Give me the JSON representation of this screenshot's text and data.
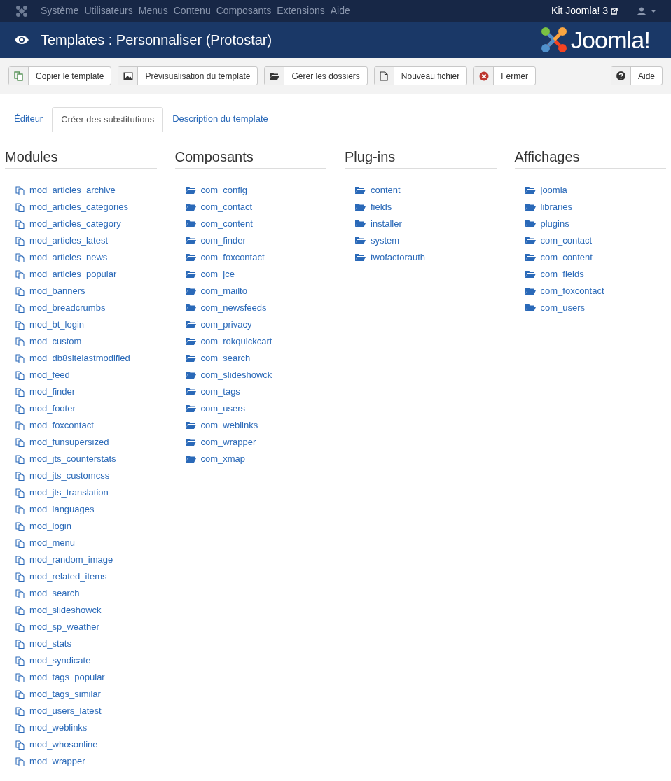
{
  "topbar": {
    "menu": [
      "Système",
      "Utilisateurs",
      "Menus",
      "Contenu",
      "Composants",
      "Extensions",
      "Aide"
    ],
    "site_link": "Kit Joomla! 3"
  },
  "header": {
    "title": "Templates : Personnaliser (Protostar)",
    "logo_text": "Joomla!"
  },
  "toolbar": {
    "buttons": [
      "Copier le template",
      "Prévisualisation du template",
      "Gérer les dossiers",
      "Nouveau fichier",
      "Fermer"
    ],
    "help_button": "Aide"
  },
  "tabs": [
    {
      "label": "Éditeur",
      "selected": false
    },
    {
      "label": "Créer des substitutions",
      "selected": true
    },
    {
      "label": "Description du template",
      "selected": false
    }
  ],
  "columns": [
    {
      "kind": "files",
      "title": "Modules",
      "items": [
        "mod_articles_archive",
        "mod_articles_categories",
        "mod_articles_category",
        "mod_articles_latest",
        "mod_articles_news",
        "mod_articles_popular",
        "mod_banners",
        "mod_breadcrumbs",
        "mod_bt_login",
        "mod_custom",
        "mod_db8sitelastmodified",
        "mod_feed",
        "mod_finder",
        "mod_footer",
        "mod_foxcontact",
        "mod_funsupersized",
        "mod_jts_counterstats",
        "mod_jts_customcss",
        "mod_jts_translation",
        "mod_languages",
        "mod_login",
        "mod_menu",
        "mod_random_image",
        "mod_related_items",
        "mod_search",
        "mod_slideshowck",
        "mod_sp_weather",
        "mod_stats",
        "mod_syndicate",
        "mod_tags_popular",
        "mod_tags_similar",
        "mod_users_latest",
        "mod_weblinks",
        "mod_whosonline",
        "mod_wrapper"
      ]
    },
    {
      "kind": "folders",
      "title": "Composants",
      "items": [
        "com_config",
        "com_contact",
        "com_content",
        "com_finder",
        "com_foxcontact",
        "com_jce",
        "com_mailto",
        "com_newsfeeds",
        "com_privacy",
        "com_rokquickcart",
        "com_search",
        "com_slideshowck",
        "com_tags",
        "com_users",
        "com_weblinks",
        "com_wrapper",
        "com_xmap"
      ]
    },
    {
      "kind": "folders",
      "title": "Plug-ins",
      "items": [
        "content",
        "fields",
        "installer",
        "system",
        "twofactorauth"
      ]
    },
    {
      "kind": "folders",
      "title": "Affichages",
      "items": [
        "joomla",
        "libraries",
        "plugins",
        "com_contact",
        "com_content",
        "com_fields",
        "com_foxcontact",
        "com_users"
      ]
    }
  ]
}
